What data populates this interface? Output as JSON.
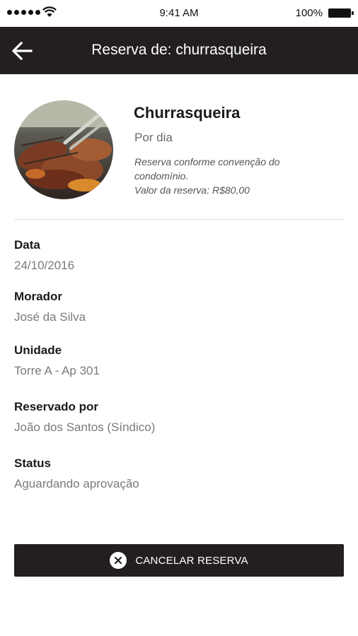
{
  "status_bar": {
    "time": "9:41 AM",
    "battery": "100%"
  },
  "header": {
    "title": "Reserva de: churrasqueira",
    "back_icon": "arrow-left-icon"
  },
  "facility": {
    "name": "Churrasqueira",
    "period": "Por dia",
    "note_lines": [
      "Reserva conforme convenção do",
      "condomínio.",
      "Valor da reserva: R$80,00"
    ]
  },
  "details": [
    {
      "label": "Data",
      "value": "24/10/2016"
    },
    {
      "label": "Morador",
      "value": "José da Silva"
    },
    {
      "label": "Unidade",
      "value": "Torre A - Ap 301"
    },
    {
      "label": "Reservado por",
      "value": "João dos Santos (Síndico)"
    },
    {
      "label": "Status",
      "value": "Aguardando aprovação"
    }
  ],
  "cancel_button": {
    "label": "CANCELAR RESERVA",
    "icon": "close-circle-icon"
  },
  "colors": {
    "header_bg": "#231f20",
    "button_bg": "#231f20",
    "value_text": "#7a7a7a"
  }
}
